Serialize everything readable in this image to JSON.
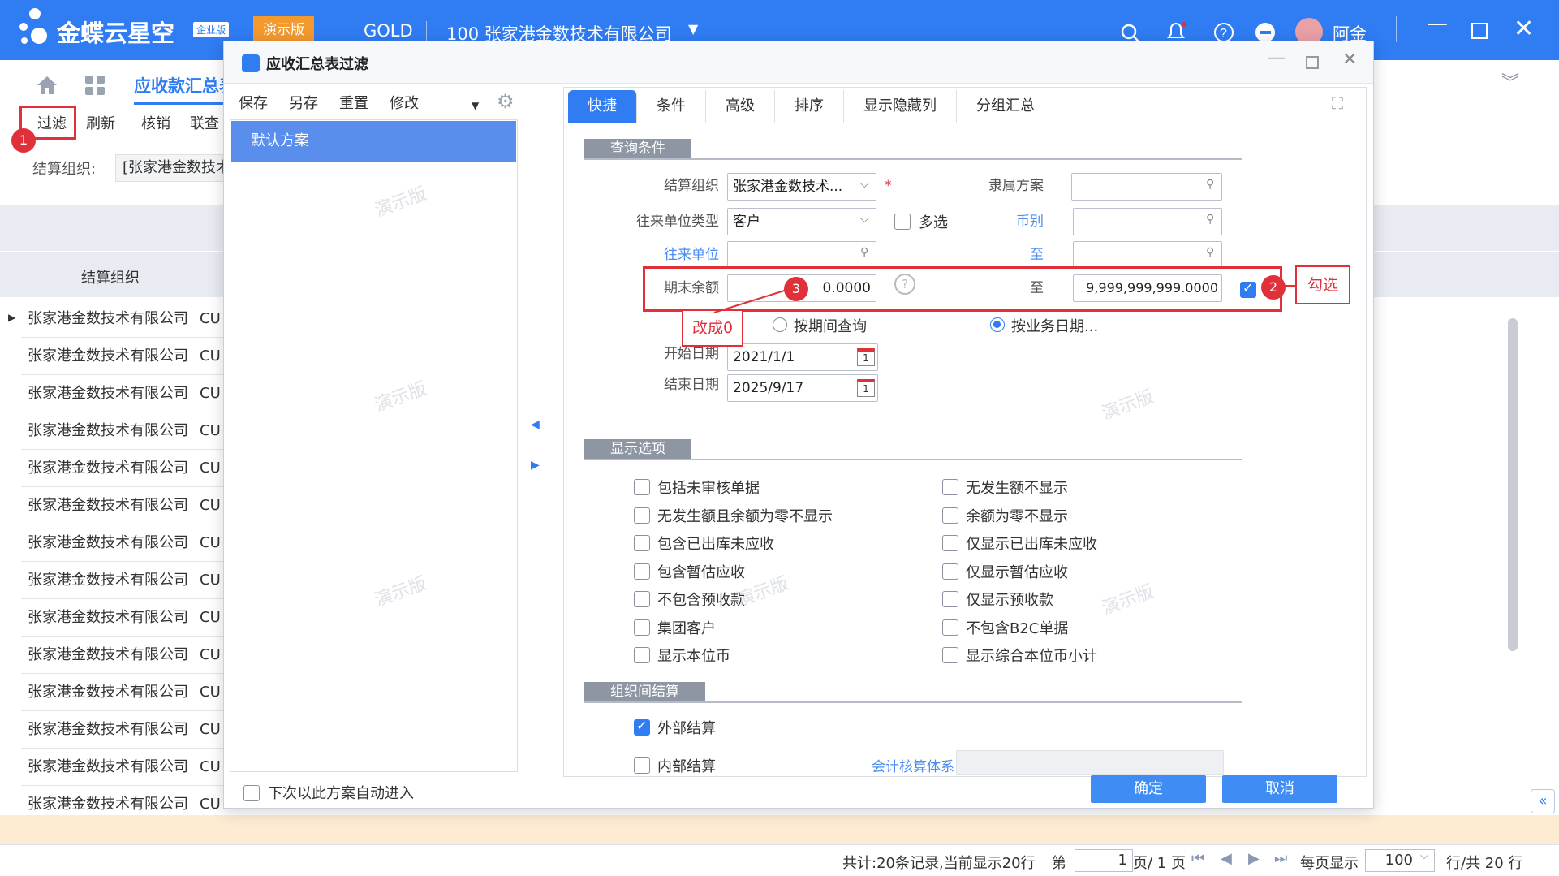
{
  "app": {
    "brand": "金蝶云星空",
    "edition_badge": "企业版",
    "demo_badge": "演示版",
    "env": "GOLD",
    "org": "100 张家港金数技术有限公司",
    "user": "阿金"
  },
  "ribbon": {
    "tab": "应收款汇总表"
  },
  "toolbar": {
    "items": [
      "过滤",
      "刷新",
      "核销",
      "联查"
    ]
  },
  "filterbar": {
    "label": "结算组织:",
    "value": "[张家港金数技术"
  },
  "grid": {
    "col_header": "结算组织",
    "rows": [
      "张家港金数技术有限公司",
      "张家港金数技术有限公司",
      "张家港金数技术有限公司",
      "张家港金数技术有限公司",
      "张家港金数技术有限公司",
      "张家港金数技术有限公司",
      "张家港金数技术有限公司",
      "张家港金数技术有限公司",
      "张家港金数技术有限公司",
      "张家港金数技术有限公司",
      "张家港金数技术有限公司",
      "张家港金数技术有限公司",
      "张家港金数技术有限公司",
      "张家港金数技术有限公司"
    ],
    "cu": "CU"
  },
  "dialog": {
    "title": "应收汇总表过滤",
    "scheme_actions": [
      "保存",
      "另存",
      "重置",
      "修改"
    ],
    "scheme_default": "默认方案",
    "auto_enter": "下次以此方案自动进入",
    "tabs": [
      "快捷",
      "条件",
      "高级",
      "排序",
      "显示隐藏列",
      "分组汇总"
    ],
    "section_query": "查询条件",
    "settle_org_label": "结算组织",
    "settle_org_value": "张家港金数技术...",
    "affiliation_label": "隶属方案",
    "partner_type_label": "往来单位类型",
    "partner_type_value": "客户",
    "multi_select": "多选",
    "currency_label": "币别",
    "partner_label": "往来单位",
    "to_label": "至",
    "end_balance_label": "期末余额",
    "end_balance_from": "0.0000",
    "end_balance_to": "9,999,999,999.0000",
    "period_query": "按期间查询",
    "bizdate_query": "按业务日期...",
    "start_date_label": "开始日期",
    "start_date": "2021/1/1",
    "end_date_label": "结束日期",
    "end_date": "2025/9/17",
    "section_display": "显示选项",
    "display_left": [
      "包括未审核单据",
      "无发生额且余额为零不显示",
      "包含已出库未应收",
      "包含暂估应收",
      "不包含预收款",
      "集团客户",
      "显示本位币"
    ],
    "display_right": [
      "无发生额不显示",
      "余额为零不显示",
      "仅显示已出库未应收",
      "仅显示暂估应收",
      "仅显示预收款",
      "不包含B2C单据",
      "显示综合本位币小计"
    ],
    "section_interorg": "组织间结算",
    "external": "外部结算",
    "internal": "内部结算",
    "accounting_system": "会计核算体系",
    "ok": "确定",
    "cancel": "取消"
  },
  "annotations": {
    "b1": "1",
    "b2": "2",
    "b3": "3",
    "check_note": "勾选",
    "zero_note": "改成0"
  },
  "watermark": "演示版",
  "footer": {
    "summary": "共计:20条记录,当前显示20行",
    "page_prefix": "第",
    "page_value": "1",
    "page_suffix": "页/ 1 页",
    "per_page_label": "每页显示",
    "per_page_value": "100",
    "rows_total": "行/共 20 行"
  },
  "colors": {
    "primary": "#2f7cf3",
    "red": "#e0313b"
  }
}
